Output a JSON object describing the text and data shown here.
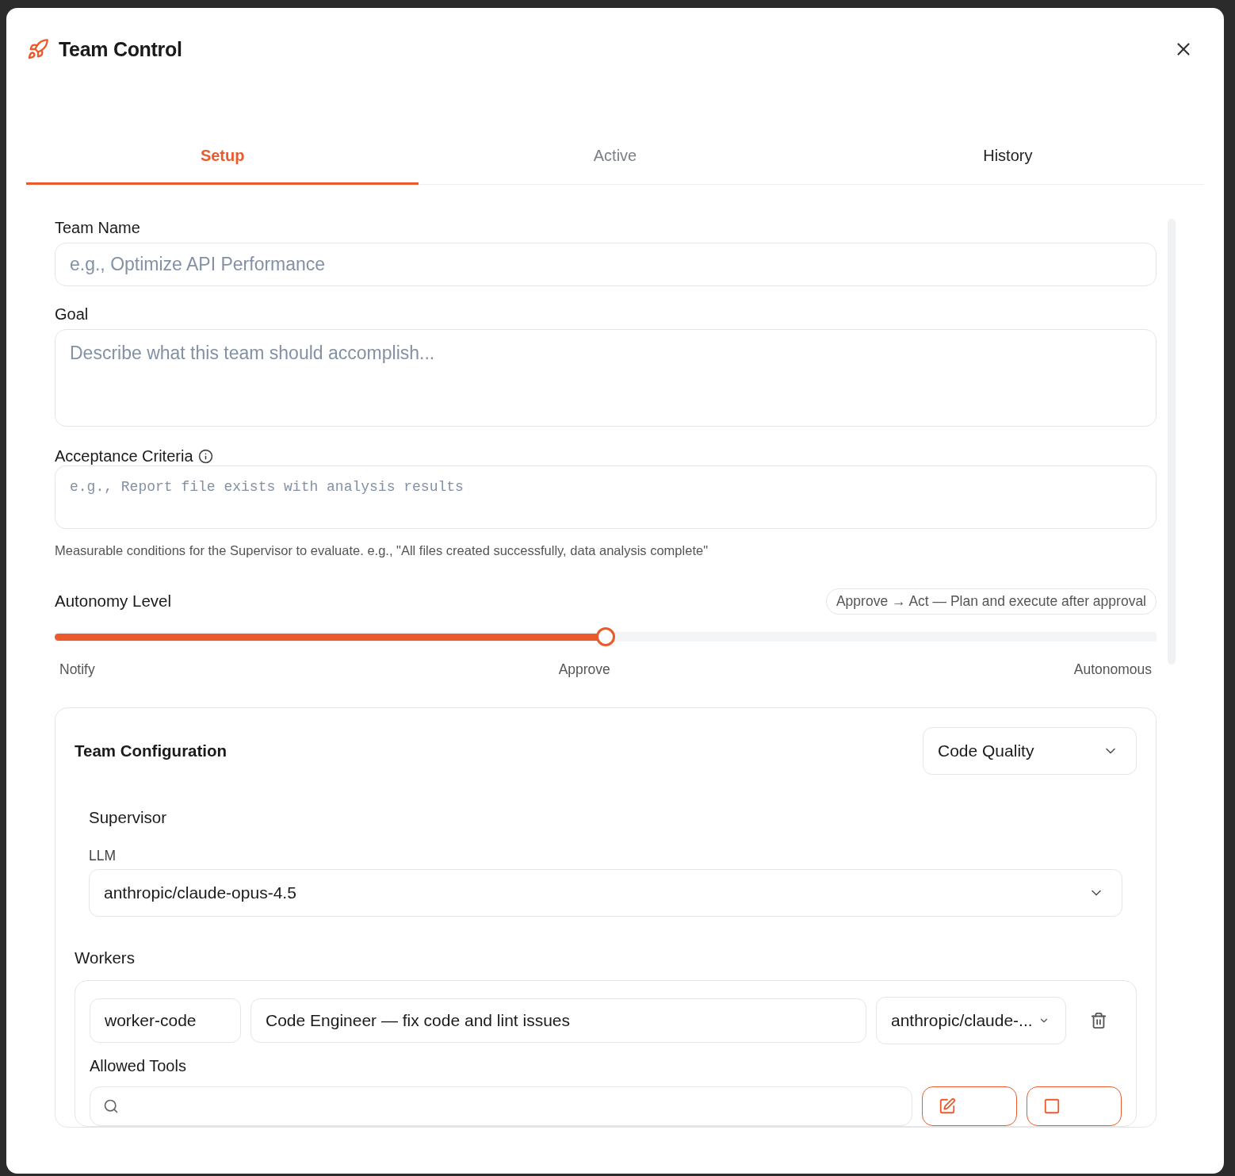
{
  "dialog": {
    "title": "Team Control"
  },
  "tabs": [
    {
      "label": "Setup",
      "selected": true,
      "highlighted": false
    },
    {
      "label": "Active",
      "selected": false,
      "highlighted": false
    },
    {
      "label": "History",
      "selected": false,
      "highlighted": true
    }
  ],
  "team_name": {
    "label": "Team Name",
    "placeholder": "e.g., Optimize API Performance"
  },
  "goal": {
    "label": "Goal",
    "placeholder": "Describe what this team should accomplish..."
  },
  "acceptance_criteria": {
    "label": "Acceptance Criteria",
    "placeholder": "e.g., Report file exists with analysis results",
    "hint": "Measurable conditions for the Supervisor to evaluate. e.g., \"All files created successfully, data analysis complete\""
  },
  "autonomy": {
    "label": "Autonomy Level",
    "badge": "Approve → Act — Plan and execute after approval",
    "level": 0.5,
    "stops": [
      "Notify",
      "Approve",
      "Autonomous"
    ]
  },
  "team_configuration": {
    "title": "Team Configuration",
    "preset": "Code Quality",
    "supervisor": {
      "title": "Supervisor",
      "llm_label": "LLM",
      "llm": "anthropic/claude-opus-4.5"
    },
    "workers_title": "Workers",
    "workers": [
      {
        "id": "worker-code",
        "role": "Code Engineer — fix code and lint issues",
        "model": "anthropic/claude-...",
        "allowed_tools_label": "Allowed Tools"
      }
    ]
  }
}
